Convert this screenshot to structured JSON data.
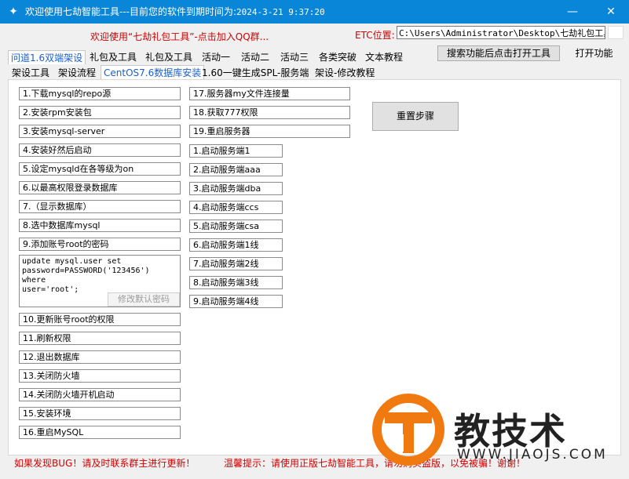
{
  "window": {
    "title_prefix": "欢迎使用七劫智能工具---目前您的软件到期时间为:",
    "expiry": "2024-3-21  9:37:20",
    "minimize_label": "—",
    "close_label": "✕"
  },
  "header": {
    "welcome": "欢迎使用“七劫礼包工具”-点击加入QQ群...",
    "etc_label": "ETC位置:",
    "etc_path": "C:\\Users\\Administrator\\Desktop\\七劫礼包工具",
    "search_button": "搜索功能后点击打开工具",
    "open_button": "打开功能"
  },
  "tabs_row1": [
    "问道1.6双端架设",
    "礼包及工具",
    "礼包及工具",
    "活动一",
    "活动二",
    "活动三",
    "各类突破",
    "文本教程"
  ],
  "tabs_row2": [
    "架设工具",
    "架设流程",
    "CentOS7.6数据库安装",
    "1.60一键生成SPL-服务端",
    "架设-修改教程"
  ],
  "steps_left": [
    "1.下载mysql的repo源",
    "2.安装rpm安装包",
    "3.安装mysql-server",
    "4.安装好然后启动",
    "5.设定mysqld在各等级为on",
    "6.以最高权限登录数据库",
    "7.（显示数据库）",
    "8.选中数据库mysql",
    "9.添加账号root的密码"
  ],
  "sql_text": "update mysql.user set\npassword=PASSWORD('123456') where\nuser='root';",
  "modify_button": "修改默认密码",
  "steps_left2": [
    "10.更新账号root的权限",
    "11.刷新权限",
    "12.退出数据库",
    "13.关闭防火墙",
    "14.关闭防火墙开机启动",
    "15.安装环境",
    "16.重启MySQL"
  ],
  "steps_mid": [
    "17.服务器my文件连接量",
    "18.获取777权限",
    "19.重启服务器"
  ],
  "service_steps": [
    "1.启动服务端1",
    "2.启动服务端aaa",
    "3.启动服务端dba",
    "4.启动服务端ccs",
    "5.启动服务端csa",
    "6.启动服务端1线",
    "7.启动服务端2线",
    "8.启动服务端3线",
    "9.启动服务端4线"
  ],
  "reset_button": "重置步骤",
  "footer": {
    "left": "如果发现BUG！请及时联系群主进行更新！",
    "right": "温馨提示：请使用正版七劫智能工具，请勿购买盗版，以免被骗！谢谢！"
  },
  "watermark": {
    "text": "教技术",
    "url": "WWW.JIAOJS.COM"
  },
  "colors": {
    "titlebar": "#0a86d8",
    "accent_red": "#d40000",
    "tab_active": "#1a5fd0",
    "logo_orange": "#f07a10"
  }
}
